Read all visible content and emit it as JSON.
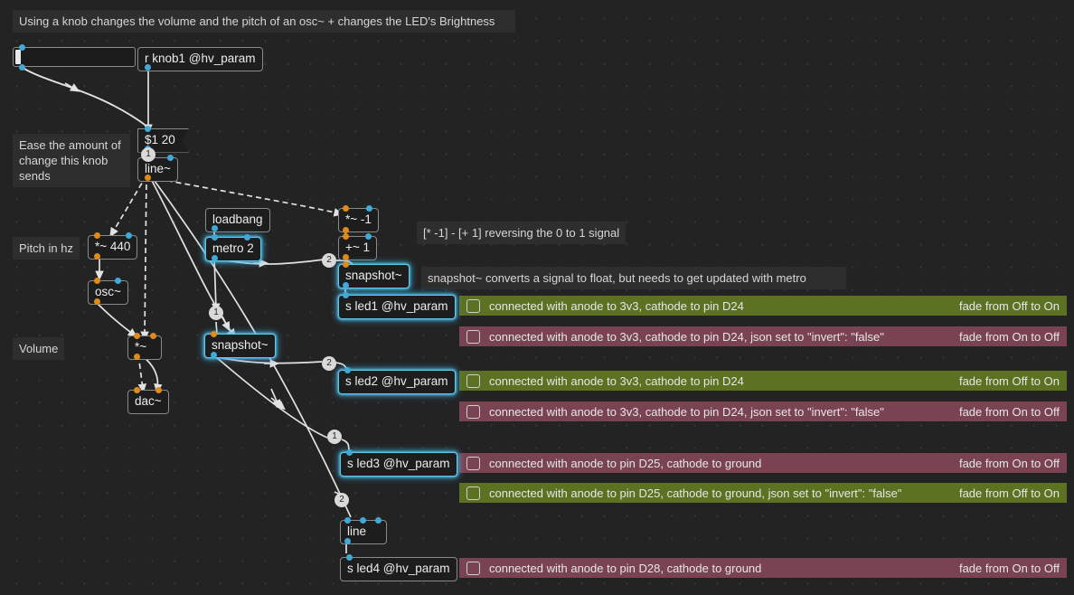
{
  "canvas": {
    "background": "#232323",
    "grid_color": "#3b3b3b",
    "accent_glow": "#5fc8ee",
    "signal_port_color": "#e08a18",
    "control_port_color": "#3fa9d8",
    "green_row": "#5c7222",
    "red_row": "#7a4352"
  },
  "comments": {
    "title": "Using a knob changes the volume and the pitch of an osc~ + changes the LED's Brightness",
    "ease": "Ease the amount of\nchange this knob\nsends",
    "pitch": "Pitch in hz",
    "volume": "Volume",
    "reverse": "[* -1] - [+ 1] reversing the 0 to 1 signal",
    "snapshot": "snapshot~ converts a signal to float, but needs to get updated with metro"
  },
  "objects": {
    "r_knob1": "r knob1 @hv_param",
    "msg_s1_20": "$1 20",
    "line_tilde": "line~",
    "times_440": "*~ 440",
    "osc": "osc~",
    "times": "*~",
    "dac": "dac~",
    "loadbang": "loadbang",
    "metro2": "metro 2",
    "times_neg1": "*~ -1",
    "plus_1": "+~ 1",
    "snapshot1": "snapshot~",
    "snapshot2": "snapshot~",
    "s_led1": "s led1 @hv_param",
    "s_led2": "s led2 @hv_param",
    "s_led3": "s led3 @hv_param",
    "s_led4": "s led4 @hv_param",
    "line": "line"
  },
  "badges": {
    "b1": "1",
    "b2": "2",
    "b3": "1",
    "b4": "2",
    "b5": "1",
    "b6": "2"
  },
  "led_rows": [
    {
      "id": "led1-off-to-on",
      "color": "green",
      "text": "connected with anode to 3v3, cathode to pin D24",
      "fade": "fade from Off to On"
    },
    {
      "id": "led1-on-to-off",
      "color": "red",
      "text": "connected with anode to 3v3, cathode to pin D24, json set to \"invert\": \"false\"",
      "fade": "fade from On to Off"
    },
    {
      "id": "led2-off-to-on",
      "color": "green",
      "text": "connected with anode to 3v3, cathode to pin D24",
      "fade": "fade from Off to On"
    },
    {
      "id": "led2-on-to-off",
      "color": "red",
      "text": "connected with anode to 3v3, cathode to pin D24, json set to \"invert\": \"false\"",
      "fade": "fade from On to Off"
    },
    {
      "id": "led3-on-to-off",
      "color": "red",
      "text": "connected with anode to pin D25, cathode to ground",
      "fade": "fade from On to Off"
    },
    {
      "id": "led3-off-to-on",
      "color": "green",
      "text": "connected with anode to pin D25, cathode to ground, json set to \"invert\": \"false\"",
      "fade": "fade from Off to On"
    },
    {
      "id": "led4-on-to-off",
      "color": "red",
      "text": "connected with anode to pin D28, cathode to ground",
      "fade": "fade from On to Off"
    }
  ]
}
